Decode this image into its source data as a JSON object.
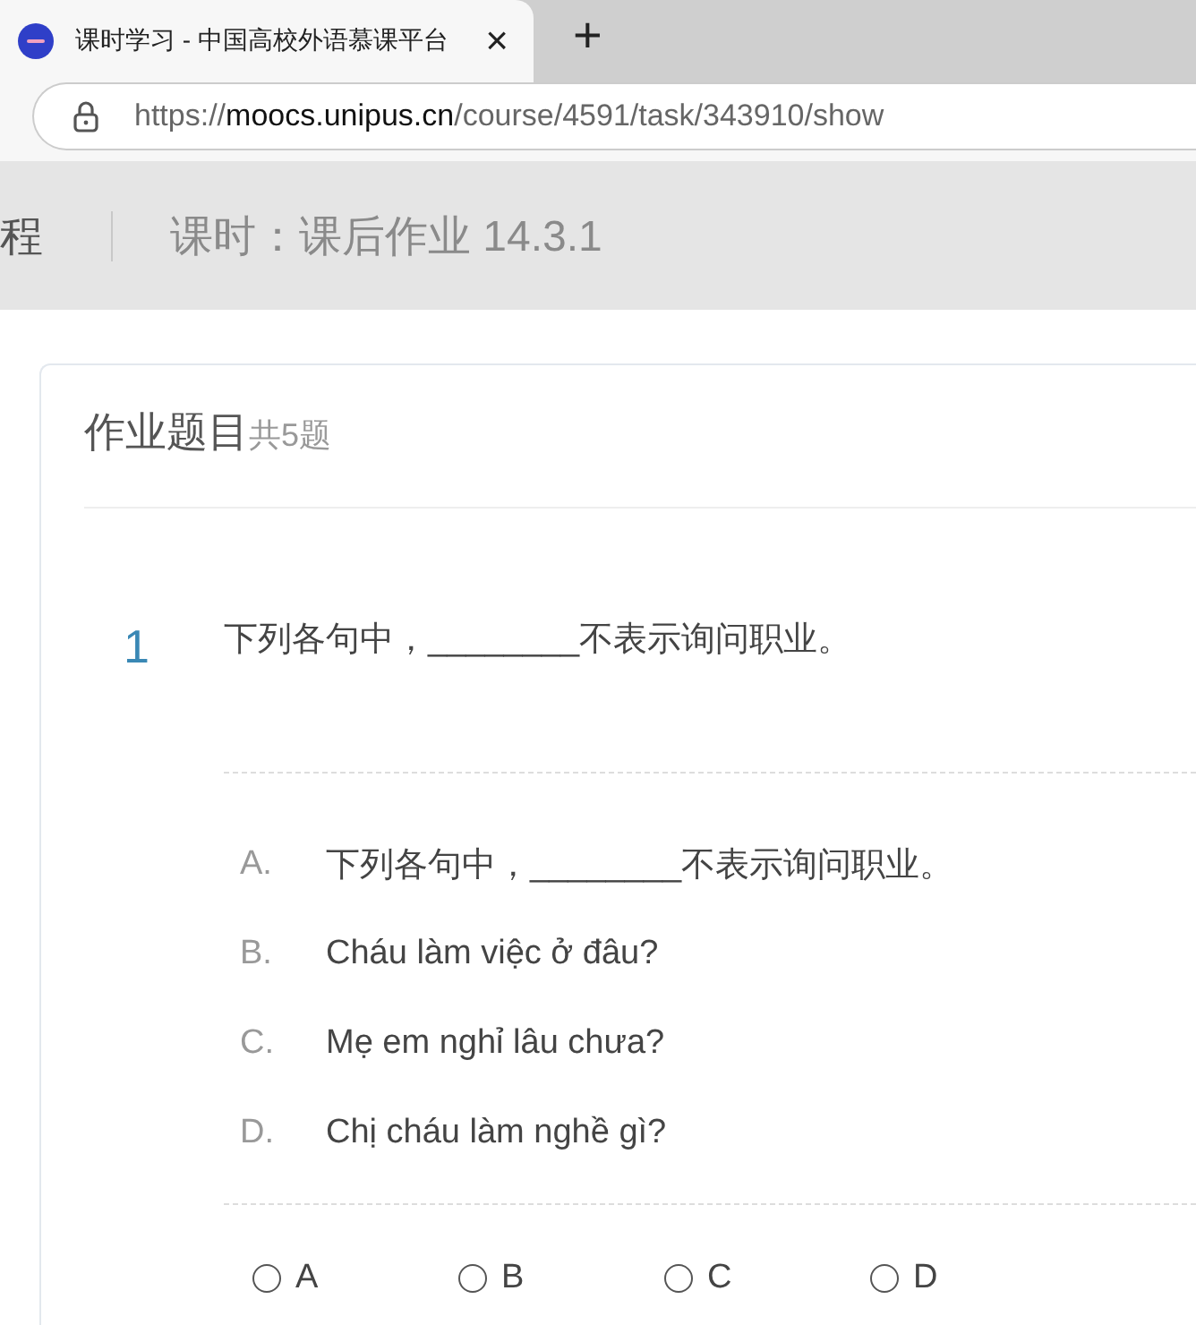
{
  "browser": {
    "tab": {
      "title": "课时学习 - 中国高校外语慕课平台",
      "close": "×"
    },
    "new_tab": "+",
    "url": {
      "scheme": "https://",
      "host": "moocs.unipus.cn",
      "path": "/course/4591/task/343910/show"
    }
  },
  "header": {
    "crumb": "程",
    "lesson": "课时：课后作业 14.3.1"
  },
  "card": {
    "title": "作业题目",
    "count": "共5题"
  },
  "question": {
    "number": "1",
    "text": "下列各句中，________不表示询问职业。",
    "choices": [
      {
        "letter": "A.",
        "text": "下列各句中，________不表示询问职业。"
      },
      {
        "letter": "B.",
        "text": "Cháu làm việc ở đâu?"
      },
      {
        "letter": "C.",
        "text": "Mẹ em nghỉ lâu chưa?"
      },
      {
        "letter": "D.",
        "text": "Chị cháu làm nghề gì?"
      }
    ],
    "answers": [
      {
        "label": "A",
        "selected": false
      },
      {
        "label": "B",
        "selected": false
      },
      {
        "label": "C",
        "selected": false
      },
      {
        "label": "D",
        "selected": false
      }
    ]
  }
}
